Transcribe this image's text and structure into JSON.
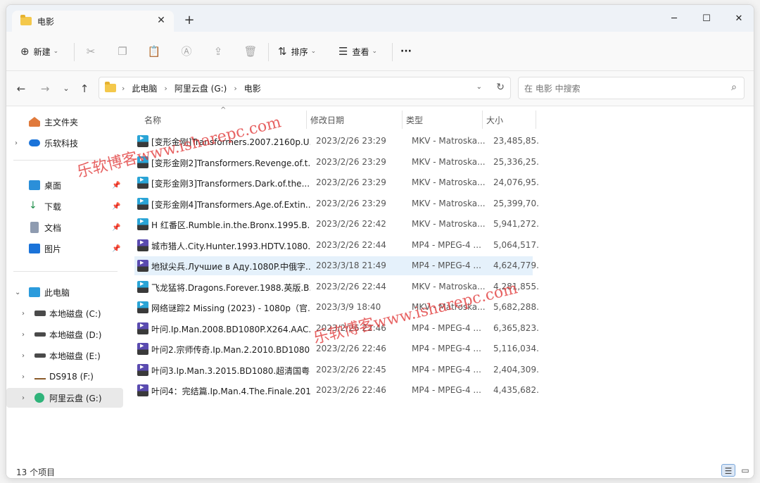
{
  "window": {
    "tab_title": "电影",
    "tab_close": "✕",
    "new_tab": "+",
    "minimize": "─",
    "maximize": "☐",
    "close": "✕"
  },
  "commandbar": {
    "new_label": "新建",
    "sort_label": "排序",
    "view_label": "查看",
    "more": "···"
  },
  "address": {
    "crumbs": [
      "此电脑",
      "阿里云盘 (G:)",
      "电影"
    ],
    "search_placeholder": "在 电影 中搜索"
  },
  "sidebar": {
    "items": [
      {
        "label": "主文件夹"
      },
      {
        "label": "乐软科技"
      },
      {
        "label": "桌面"
      },
      {
        "label": "下载"
      },
      {
        "label": "文档"
      },
      {
        "label": "图片"
      },
      {
        "label": "此电脑"
      },
      {
        "label": "本地磁盘 (C:)"
      },
      {
        "label": "本地磁盘 (D:)"
      },
      {
        "label": "本地磁盘 (E:)"
      },
      {
        "label": "DS918 (F:)"
      },
      {
        "label": "阿里云盘 (G:)"
      }
    ]
  },
  "columns": {
    "name": "名称",
    "date": "修改日期",
    "type": "类型",
    "size": "大小"
  },
  "files": [
    {
      "name": "[变形金刚]Transformers.2007.2160p.U...",
      "date": "2023/2/26 23:29",
      "type": "MKV - Matroska...",
      "size": "23,485,85...",
      "icon": "mkv"
    },
    {
      "name": "[变形金刚2]Transformers.Revenge.of.t...",
      "date": "2023/2/26 23:29",
      "type": "MKV - Matroska...",
      "size": "25,336,25...",
      "icon": "mkv"
    },
    {
      "name": "[变形金刚3]Transformers.Dark.of.the....",
      "date": "2023/2/26 23:29",
      "type": "MKV - Matroska...",
      "size": "24,076,95...",
      "icon": "mkv"
    },
    {
      "name": "[变形金刚4]Transformers.Age.of.Extin...",
      "date": "2023/2/26 23:29",
      "type": "MKV - Matroska...",
      "size": "25,399,70...",
      "icon": "mkv"
    },
    {
      "name": "H 红番区.Rumble.in.the.Bronx.1995.B...",
      "date": "2023/2/26 22:42",
      "type": "MKV - Matroska...",
      "size": "5,941,272...",
      "icon": "mkv"
    },
    {
      "name": "城市猎人.City.Hunter.1993.HDTV.1080...",
      "date": "2023/2/26 22:44",
      "type": "MP4 - MPEG-4 ...",
      "size": "5,064,517...",
      "icon": "mp4"
    },
    {
      "name": "地狱尖兵.Лучшие в Аду.1080P.中俄字...",
      "date": "2023/3/18 21:49",
      "type": "MP4 - MPEG-4 ...",
      "size": "4,624,779...",
      "icon": "mp4"
    },
    {
      "name": "飞龙猛将.Dragons.Forever.1988.英版.B...",
      "date": "2023/2/26 22:44",
      "type": "MKV - Matroska...",
      "size": "4,281,855...",
      "icon": "mkv"
    },
    {
      "name": "网络谜踪2 Missing (2023) - 1080p（官...",
      "date": "2023/3/9 18:40",
      "type": "MKV - Matroska...",
      "size": "5,682,288...",
      "icon": "mkv"
    },
    {
      "name": "叶问.Ip.Man.2008.BD1080P.X264.AAC....",
      "date": "2023/2/26 22:46",
      "type": "MP4 - MPEG-4 ...",
      "size": "6,365,823...",
      "icon": "mp4"
    },
    {
      "name": "叶问2.宗师传奇.Ip.Man.2.2010.BD1080...",
      "date": "2023/2/26 22:46",
      "type": "MP4 - MPEG-4 ...",
      "size": "5,116,034...",
      "icon": "mp4"
    },
    {
      "name": "叶问3.Ip.Man.3.2015.BD1080.超清国粤...",
      "date": "2023/2/26 22:45",
      "type": "MP4 - MPEG-4 ...",
      "size": "2,404,309...",
      "icon": "mp4"
    },
    {
      "name": "叶问4：完结篇.Ip.Man.4.The.Finale.201...",
      "date": "2023/2/26 22:46",
      "type": "MP4 - MPEG-4 ...",
      "size": "4,435,682...",
      "icon": "mp4"
    }
  ],
  "status": {
    "count": "13 个项目"
  },
  "watermark": {
    "line1": "乐软博客www.isharepc.com",
    "line2": "乐软博客www.isharepc.com"
  },
  "colors": {
    "accent": "#0067c0",
    "selection": "#e5f1fb",
    "watermark": "#e13c3c"
  }
}
